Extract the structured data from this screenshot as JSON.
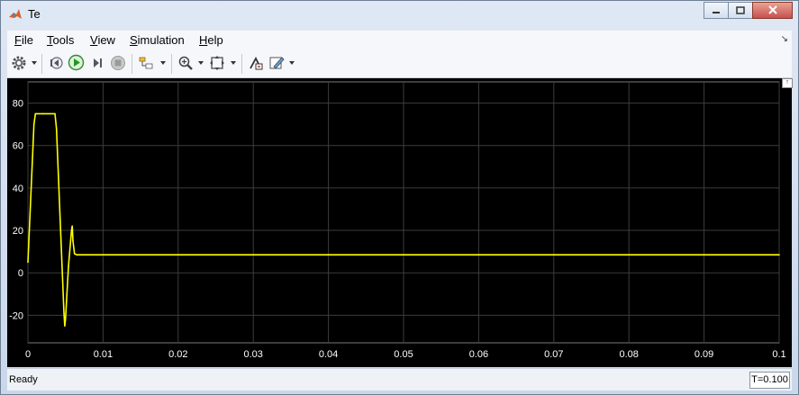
{
  "window": {
    "title": "Te",
    "icon": "matlab-icon",
    "controls": [
      "minimize-icon",
      "maximize-icon",
      "close-icon"
    ]
  },
  "menu": {
    "items": [
      {
        "label": "File",
        "mnemonic": "F",
        "rest": "ile"
      },
      {
        "label": "Tools",
        "mnemonic": "T",
        "rest": "ools"
      },
      {
        "label": "View",
        "mnemonic": "V",
        "rest": "iew"
      },
      {
        "label": "Simulation",
        "mnemonic": "S",
        "rest": "imulation"
      },
      {
        "label": "Help",
        "mnemonic": "H",
        "rest": "elp"
      }
    ]
  },
  "toolbar": {
    "icons": [
      "parameters-icon",
      "step-back-icon",
      "run-icon",
      "step-forward-icon",
      "stop-icon",
      "highlight-icon",
      "zoom-icon",
      "fit-to-view-icon",
      "legend-icon",
      "style-icon"
    ]
  },
  "status": {
    "text": "Ready",
    "time": "T=0.100"
  },
  "colors": {
    "background": "#000000",
    "grid": "#3c3c3c",
    "trace": "#ffff00",
    "ticks": "#ffffff"
  },
  "chart_data": {
    "type": "line",
    "title": "",
    "xlabel": "",
    "ylabel": "",
    "xlim": [
      0,
      0.1
    ],
    "ylim": [
      -33,
      90
    ],
    "grid": true,
    "x_ticks": [
      0,
      0.01,
      0.02,
      0.03,
      0.04,
      0.05,
      0.06,
      0.07,
      0.08,
      0.09,
      0.1
    ],
    "x_tick_labels": [
      "0",
      "0.01",
      "0.02",
      "0.03",
      "0.04",
      "0.05",
      "0.06",
      "0.07",
      "0.08",
      "0.09",
      "0.1"
    ],
    "y_ticks": [
      -20,
      0,
      20,
      40,
      60,
      80
    ],
    "y_tick_labels": [
      "-20",
      "0",
      "20",
      "40",
      "60",
      "80"
    ],
    "series": [
      {
        "color": "#ffff00",
        "x": [
          0,
          0.0008,
          0.001,
          0.002,
          0.0036,
          0.0038,
          0.0048,
          0.0049,
          0.005,
          0.0054,
          0.0058,
          0.0059,
          0.006,
          0.0062,
          0.0065,
          0.007,
          0.008,
          0.01,
          0.02,
          0.03,
          0.04,
          0.05,
          0.06,
          0.07,
          0.08,
          0.09,
          0.1
        ],
        "y": [
          5,
          70,
          75,
          75,
          75,
          68,
          -19,
          -25,
          -22,
          3,
          20,
          22,
          15,
          9,
          8.5,
          8.5,
          8.5,
          8.5,
          8.5,
          8.5,
          8.5,
          8.5,
          8.5,
          8.5,
          8.5,
          8.5,
          8.5
        ]
      }
    ]
  }
}
